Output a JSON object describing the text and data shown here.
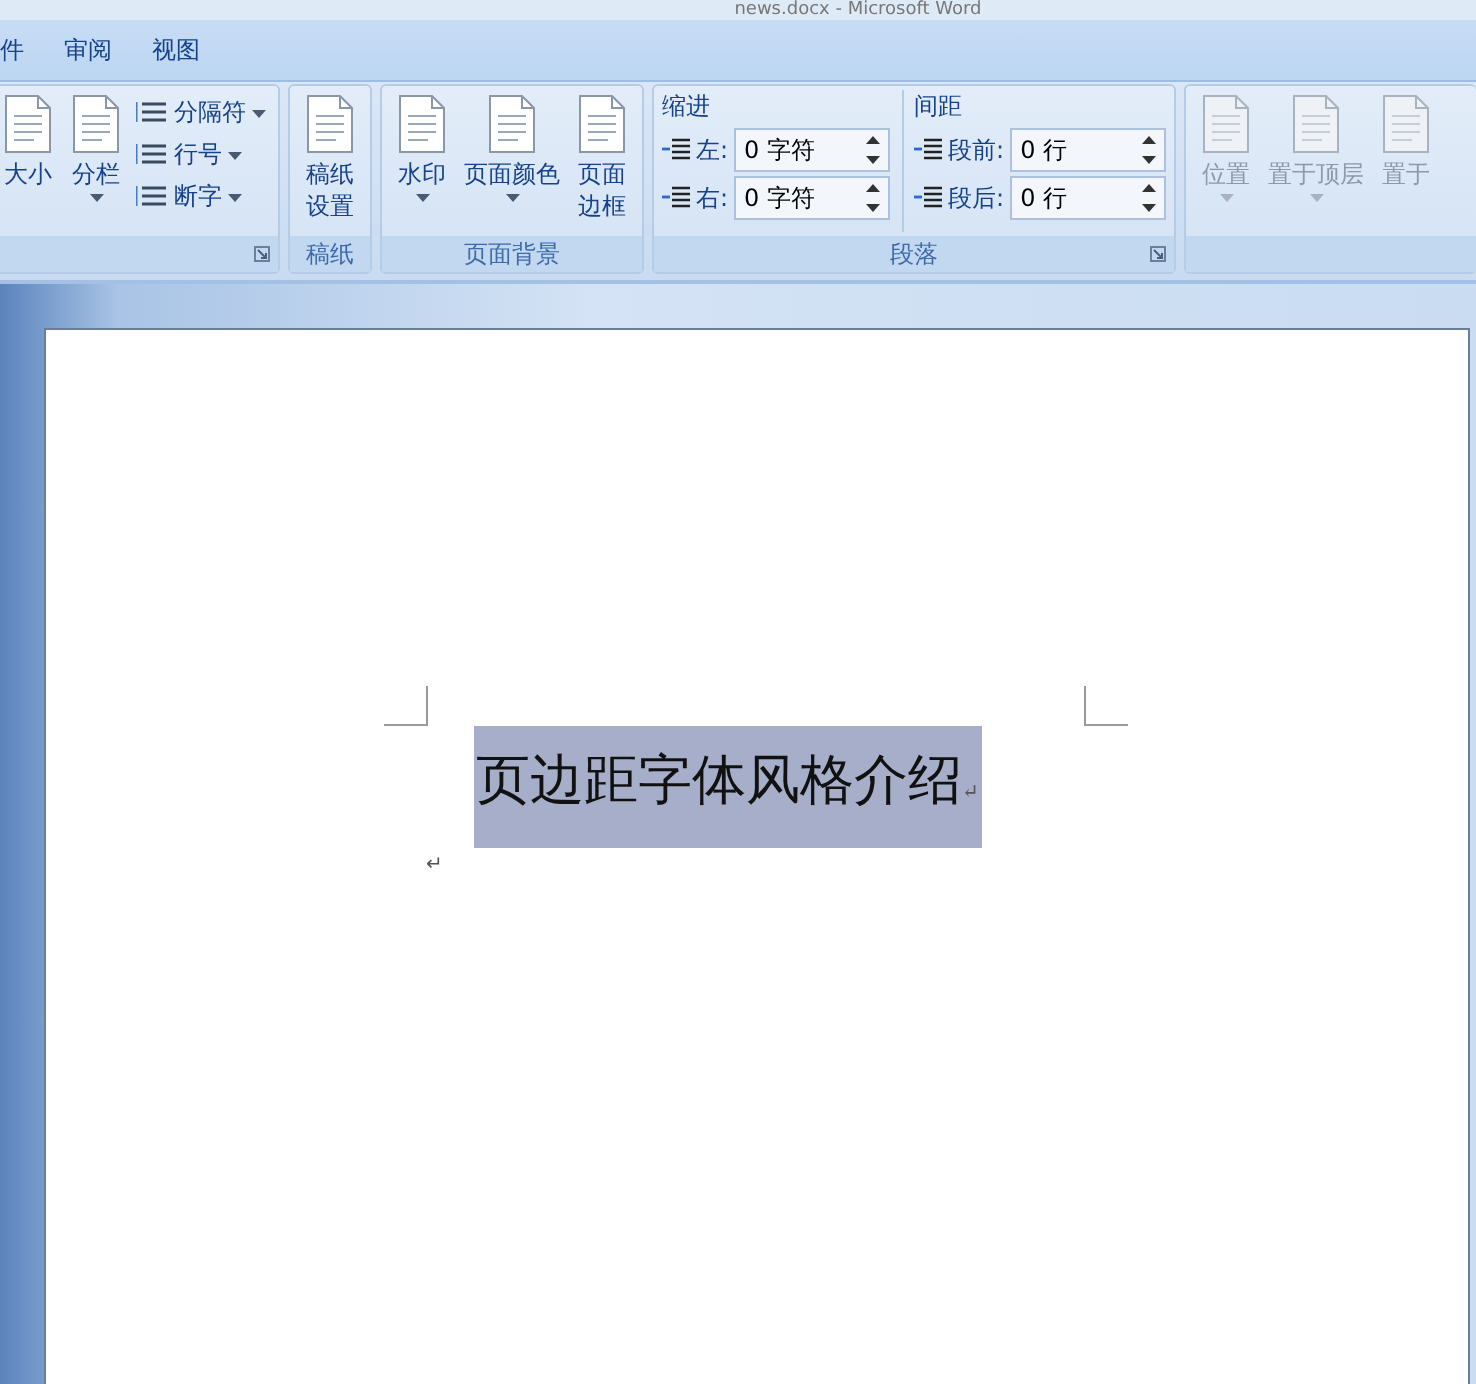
{
  "window": {
    "title": "news.docx - Microsoft Word"
  },
  "tabs": [
    {
      "label": "件",
      "selected": false
    },
    {
      "label": "审阅",
      "selected": false
    },
    {
      "label": "视图",
      "selected": false
    }
  ],
  "ribbon": {
    "groups": [
      {
        "kind": "buttons",
        "launcher": true,
        "items": [
          {
            "kind": "big",
            "lines": [
              "大小"
            ],
            "caret": false,
            "disabled": false
          },
          {
            "kind": "big",
            "lines": [
              "分栏"
            ],
            "caret": true,
            "disabled": false
          },
          {
            "kind": "small",
            "lines": [
              "分隔符"
            ],
            "caret": true,
            "disabled": false
          },
          {
            "kind": "small",
            "lines": [
              "行号"
            ],
            "caret": true,
            "disabled": false
          },
          {
            "kind": "small",
            "lines": [
              "断字"
            ],
            "caret": true,
            "disabled": false
          }
        ]
      },
      {
        "kind": "buttons",
        "label": "稿纸",
        "launcher": false,
        "items": [
          {
            "kind": "big",
            "lines": [
              "稿纸",
              "设置"
            ],
            "caret": false,
            "disabled": false
          }
        ]
      },
      {
        "kind": "buttons",
        "label": "页面背景",
        "launcher": false,
        "items": [
          {
            "kind": "big",
            "lines": [
              "水印"
            ],
            "caret": true,
            "disabled": false
          },
          {
            "kind": "big",
            "lines": [
              "页面颜色"
            ],
            "caret": true,
            "disabled": false
          },
          {
            "kind": "big",
            "lines": [
              "页面",
              "边框"
            ],
            "caret": false,
            "disabled": false
          }
        ]
      },
      {
        "kind": "paragraph",
        "label": "段落",
        "launcher": true,
        "sections": [
          {
            "title": "缩进",
            "fields": [
              {
                "label": "左:",
                "value": "0 字符"
              },
              {
                "label": "右:",
                "value": "0 字符"
              }
            ]
          },
          {
            "title": "间距",
            "fields": [
              {
                "label": "段前:",
                "value": "0 行"
              },
              {
                "label": "段后:",
                "value": "0 行"
              }
            ]
          }
        ]
      },
      {
        "kind": "buttons",
        "launcher": false,
        "items": [
          {
            "kind": "big",
            "lines": [
              "位置"
            ],
            "caret": true,
            "disabled": true
          },
          {
            "kind": "big",
            "lines": [
              "置于顶层"
            ],
            "caret": true,
            "disabled": true
          },
          {
            "kind": "big",
            "lines": [
              "置于"
            ],
            "caret": false,
            "disabled": true
          }
        ]
      }
    ]
  },
  "document": {
    "paragraphs": [
      {
        "text": "页边距字体风格介绍",
        "mark": "↵",
        "selected": true
      },
      {
        "mark": "↵",
        "selected": false
      }
    ]
  }
}
